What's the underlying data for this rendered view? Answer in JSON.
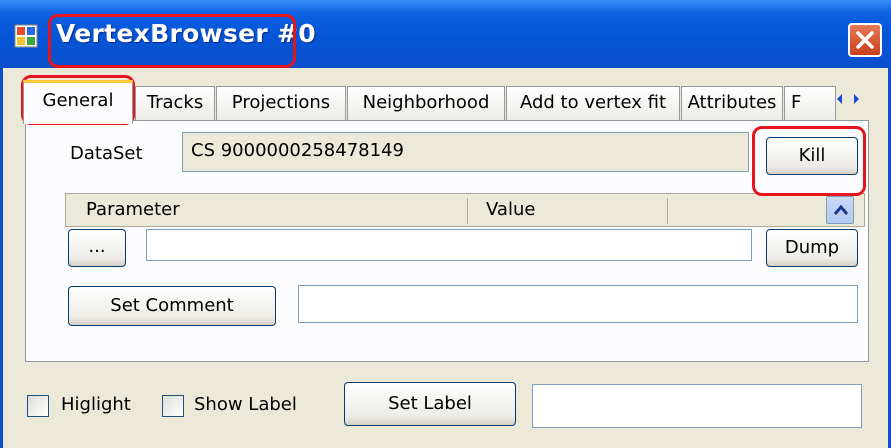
{
  "window": {
    "title": "VertexBrowser #0",
    "close_icon": "close-icon"
  },
  "tabs": [
    {
      "label": "General",
      "active": true
    },
    {
      "label": "Tracks"
    },
    {
      "label": "Projections"
    },
    {
      "label": "Neighborhood"
    },
    {
      "label": "Add to vertex fit"
    },
    {
      "label": "Attributes"
    },
    {
      "label": "F"
    }
  ],
  "general": {
    "dataset_label": "DataSet",
    "dataset_value": "CS 9000000258478149",
    "kill_label": "Kill",
    "grid_columns": [
      "Parameter",
      "Value"
    ],
    "ellipsis_label": "...",
    "dump_label": "Dump",
    "dump_input_value": "",
    "set_comment_label": "Set Comment",
    "comment_value": ""
  },
  "footer": {
    "highlight_label": "Higlight",
    "show_label_label": "Show Label",
    "set_label_label": "Set Label",
    "label_value": ""
  },
  "colors": {
    "titlebar": "#0554d6",
    "window_bg": "#ece9d8",
    "annotation_red": "#e8141c"
  }
}
